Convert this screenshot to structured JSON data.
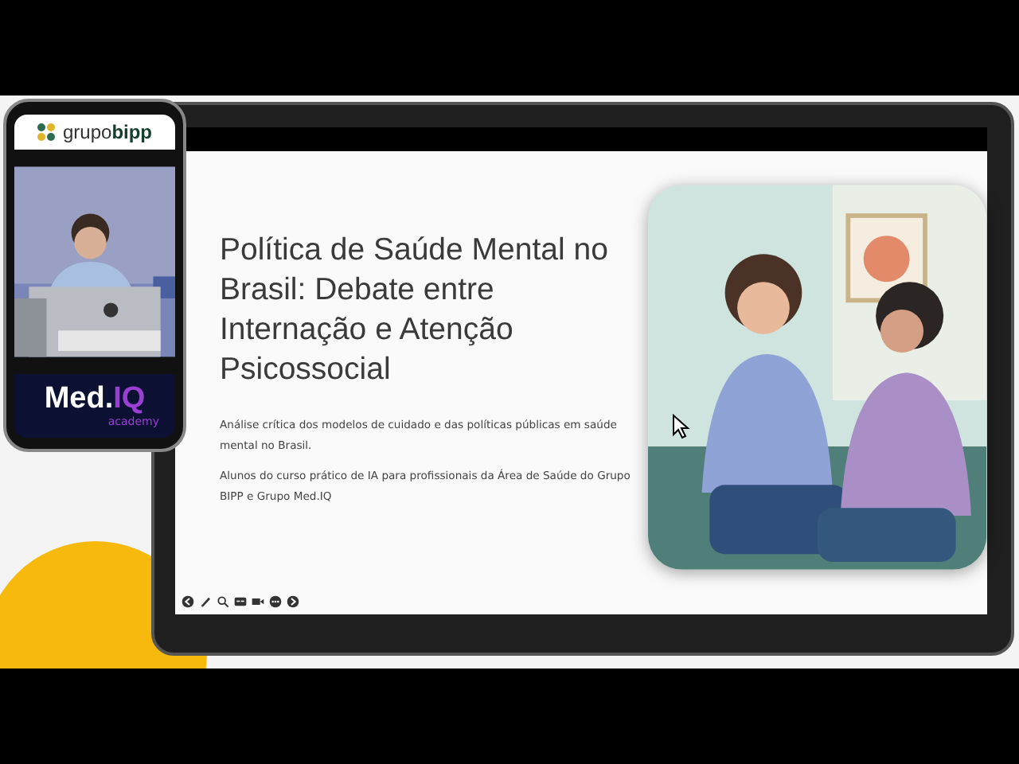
{
  "phone": {
    "logo": "grupo**bipp**",
    "brand_name": "Med.",
    "brand_suffix": "IQ",
    "brand_tagline": "academy"
  },
  "slide": {
    "title": "Política de Saúde Mental no Brasil: Debate entre Internação e Atenção Psicossocial",
    "paragraphs": [
      "Análise crítica dos modelos de cuidado e das políticas públicas em saúde mental no Brasil.",
      "Alunos do curso prático de IA para profissionais da Área de Saúde do Grupo BIPP e Grupo Med.IQ"
    ],
    "toolbar": [
      {
        "kind": "prev"
      },
      {
        "kind": "pen"
      },
      {
        "kind": "zoom"
      },
      {
        "kind": "captions"
      },
      {
        "kind": "video"
      },
      {
        "kind": "more"
      },
      {
        "kind": "next"
      }
    ]
  }
}
